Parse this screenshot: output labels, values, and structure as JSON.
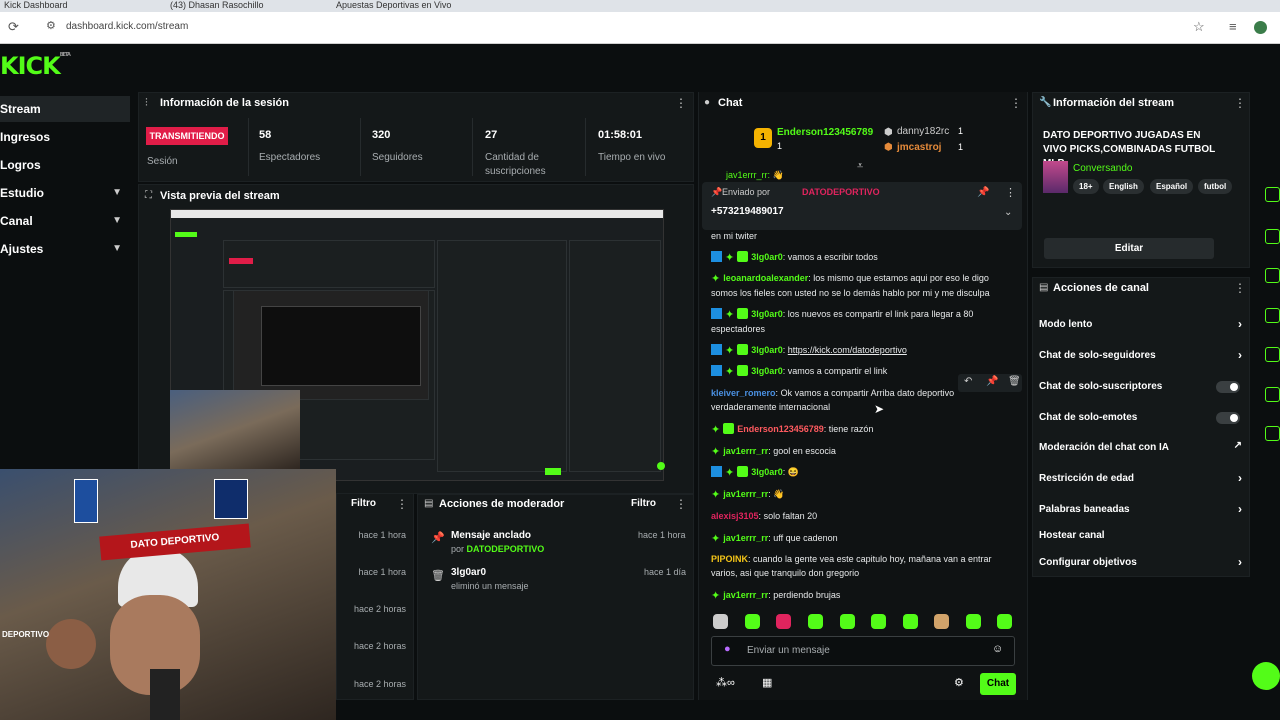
{
  "browser": {
    "tabs": [
      "Kick Dashboard",
      "(43) Dhasan Rasochillo",
      "Apuestas Deportivas en Vivo"
    ],
    "url": "dashboard.kick.com/stream"
  },
  "sidebar": {
    "logo": "KICK",
    "logo_sup": "BETA",
    "items": [
      {
        "label": "Stream"
      },
      {
        "label": "Ingresos"
      },
      {
        "label": "Logros"
      },
      {
        "label": "Estudio"
      },
      {
        "label": "Canal"
      },
      {
        "label": "Ajustes"
      }
    ]
  },
  "session": {
    "title": "Información de la sesión",
    "status": "TRANSMITIENDO",
    "status_label": "Sesión",
    "stats": [
      {
        "value": "58",
        "label": "Espectadores"
      },
      {
        "value": "320",
        "label": "Seguidores"
      },
      {
        "value": "27",
        "label": "Cantidad de suscripciones"
      },
      {
        "value": "01:58:01",
        "label": "Tiempo en vivo"
      }
    ]
  },
  "preview": {
    "title": "Vista previa del stream"
  },
  "webcam": {
    "banner": "DATO DEPORTIVO",
    "corner": "DEPORTIVO"
  },
  "filter": {
    "label": "Filtro",
    "times": [
      "hace 1 hora",
      "hace 1 hora",
      "hace 2 horas",
      "hace 2 horas",
      "hace 2 horas"
    ]
  },
  "moderator": {
    "title": "Acciones de moderador",
    "filter": "Filtro",
    "items": [
      {
        "title": "Mensaje anclado",
        "sub_prefix": "por",
        "sub_user": "DATODEPORTIVO",
        "time": "hace 1 hora"
      },
      {
        "title": "3lg0ar0",
        "sub_prefix": "eliminó un mensaje",
        "sub_user": "",
        "time": "hace 1 día"
      }
    ]
  },
  "chat": {
    "title": "Chat",
    "top_users": [
      {
        "name": "Enderson123456789",
        "count": "1"
      },
      {
        "name": "danny182rc",
        "count": "1"
      },
      {
        "name": "jmcastroj",
        "count": "1"
      }
    ],
    "pinned": {
      "label": "Enviado por",
      "user": "DATODEPORTIVO",
      "text": "+573219489017"
    },
    "top_partial": "jav1errr_rr: 👋",
    "messages": [
      {
        "user": "",
        "color": "#e7e9ea",
        "text": "en mi twiter",
        "badges": "none"
      },
      {
        "user": "3lg0ar0",
        "color": "#53fc18",
        "text": "vamos a escribir todos",
        "badges": "bdg"
      },
      {
        "user": "leoanardoalexander",
        "color": "#53fc18",
        "text": "los mismo que estamos aqui por eso le digo somos los fieles con usted no se lo demás hablo por mi y me disculpa",
        "badges": "d"
      },
      {
        "user": "3lg0ar0",
        "color": "#53fc18",
        "text": "los nuevos es compartir el link para llegar a 80 espectadores",
        "badges": "bdg"
      },
      {
        "user": "3lg0ar0",
        "color": "#53fc18",
        "text": "https://kick.com/datodeportivo",
        "badges": "bdg",
        "link": true
      },
      {
        "user": "3lg0ar0",
        "color": "#53fc18",
        "text": "vamos a compartir el link",
        "badges": "bdg"
      },
      {
        "user": "kleiver_romero",
        "color": "#4a90e2",
        "text": "Ok vamos a compartir Arriba dato deportivo verdaderamente internacional",
        "badges": "none"
      },
      {
        "user": "Enderson123456789",
        "color": "#ff5a5f",
        "text": "tiene razón",
        "badges": "dg"
      },
      {
        "user": "jav1errr_rr",
        "color": "#53fc18",
        "text": "gool en escocia",
        "badges": "d"
      },
      {
        "user": "3lg0ar0",
        "color": "#53fc18",
        "text": "😆",
        "badges": "bdg"
      },
      {
        "user": "jav1errr_rr",
        "color": "#53fc18",
        "text": "👋",
        "badges": "d"
      },
      {
        "user": "alexisj3105",
        "color": "#e0245e",
        "text": "solo faltan 20",
        "badges": "none"
      },
      {
        "user": "jav1errr_rr",
        "color": "#53fc18",
        "text": "uff que cadenon",
        "badges": "d"
      },
      {
        "user": "PIPOINK",
        "color": "#f5c518",
        "text": "cuando la gente vea este capitulo hoy, mañana van a entrar varios, asi que tranquilo don gregorio",
        "badges": "none"
      },
      {
        "user": "jav1errr_rr",
        "color": "#53fc18",
        "text": "perdiendo brujas",
        "badges": "d"
      }
    ],
    "input_placeholder": "Enviar un mensaje",
    "send_label": "Chat"
  },
  "stream_info": {
    "title": "Información del stream",
    "stream_title": "DATO DEPORTIVO JUGADAS EN VIVO PICKS,COMBINADAS FUTBOL MLB",
    "category": "Conversando",
    "tags": [
      "18+",
      "English",
      "Español",
      "futbol"
    ],
    "edit_label": "Editar"
  },
  "channel_actions": {
    "title": "Acciones de canal",
    "items": [
      {
        "label": "Modo lento",
        "control": "arrow"
      },
      {
        "label": "Chat de solo-seguidores",
        "control": "arrow"
      },
      {
        "label": "Chat de solo-suscriptores",
        "control": "toggle"
      },
      {
        "label": "Chat de solo-emotes",
        "control": "toggle"
      },
      {
        "label": "Moderación del chat con IA",
        "control": "external"
      },
      {
        "label": "Restricción de edad",
        "control": "arrow"
      },
      {
        "label": "Palabras baneadas",
        "control": "arrow"
      },
      {
        "label": "Hostear canal",
        "control": "none"
      },
      {
        "label": "Configurar objetivos",
        "control": "arrow"
      }
    ]
  },
  "colors": {
    "accent": "#53fc18",
    "live": "#e11d48",
    "bg": "#0b0e0f",
    "panel": "#141819"
  }
}
